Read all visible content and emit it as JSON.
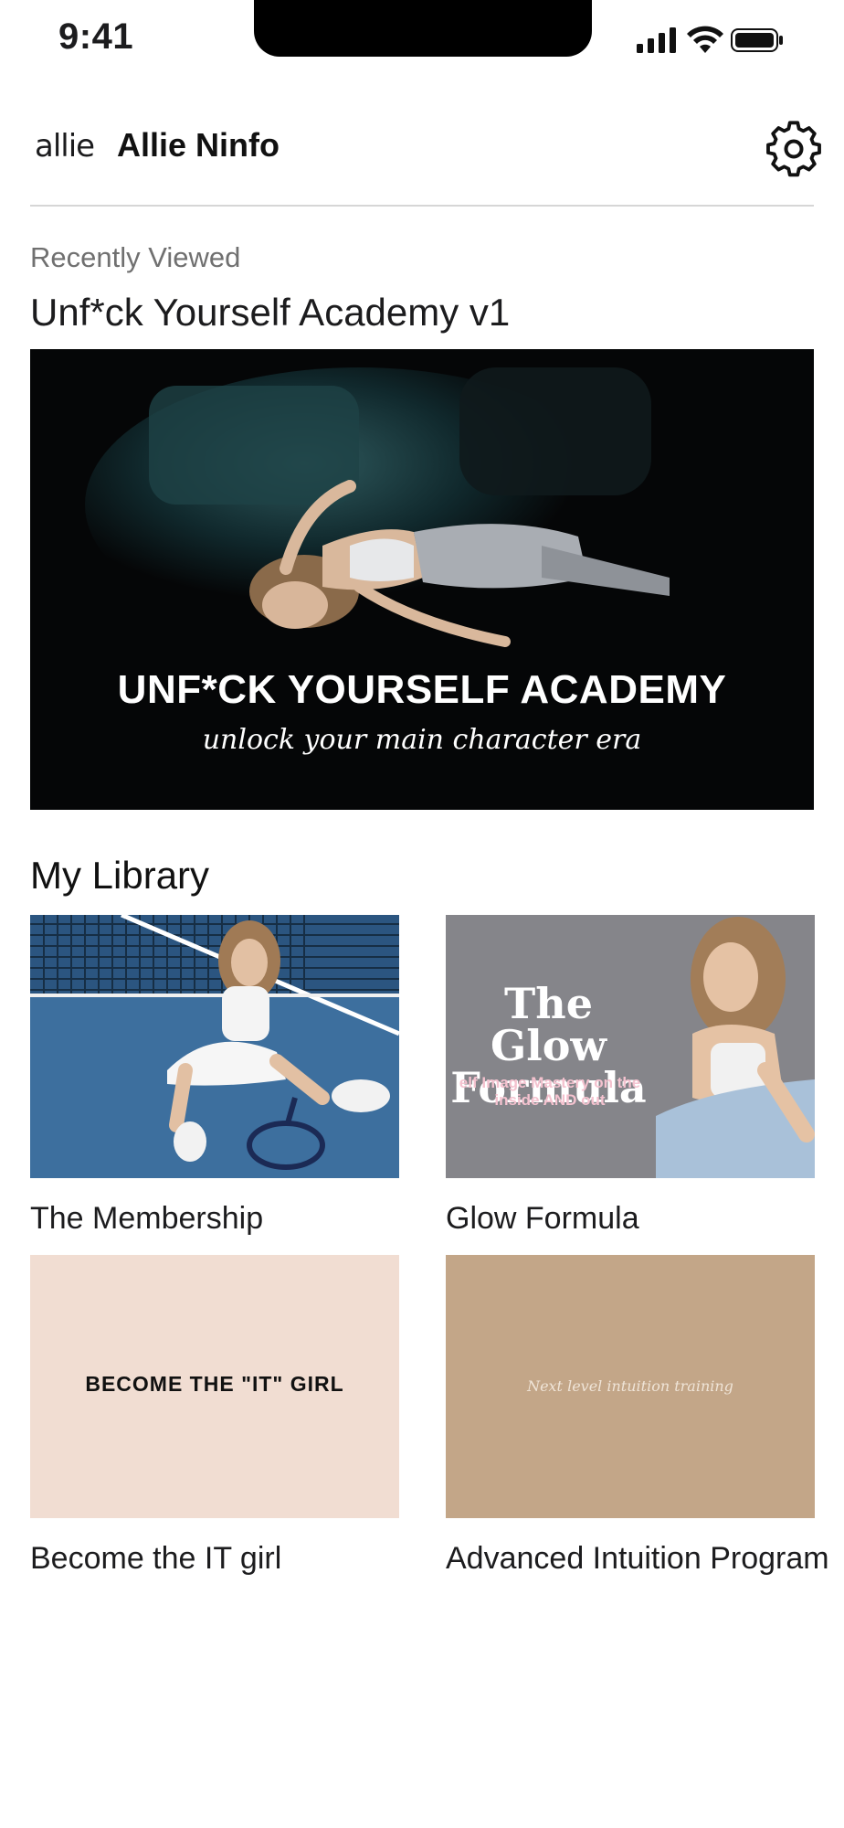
{
  "status_bar": {
    "time": "9:41"
  },
  "header": {
    "logo_text": "allie",
    "user_name": "Allie Ninfo"
  },
  "recently_viewed": {
    "label": "Recently Viewed",
    "title": "Unf*ck Yourself Academy v1",
    "hero_title": "UNF*CK YOURSELF ACADEMY",
    "hero_subtitle": "unlock your main character era"
  },
  "library": {
    "title": "My Library",
    "items": [
      {
        "label": "The Membership"
      },
      {
        "label": "Glow Formula",
        "thumb_title": "The Glow Formula",
        "thumb_subtitle": "elf Image Mastery on the inside AND out"
      },
      {
        "label": "Become the IT girl",
        "thumb_text": "BECOME THE \"IT\" GIRL"
      },
      {
        "label": "Advanced Intuition Program",
        "thumb_text": "Next level intuition training"
      }
    ]
  },
  "colors": {
    "glow_bg": "#85858a",
    "it_bg": "#f1ddd2",
    "intuition_bg": "#c3a688",
    "court_blue": "#3d6f9e"
  }
}
